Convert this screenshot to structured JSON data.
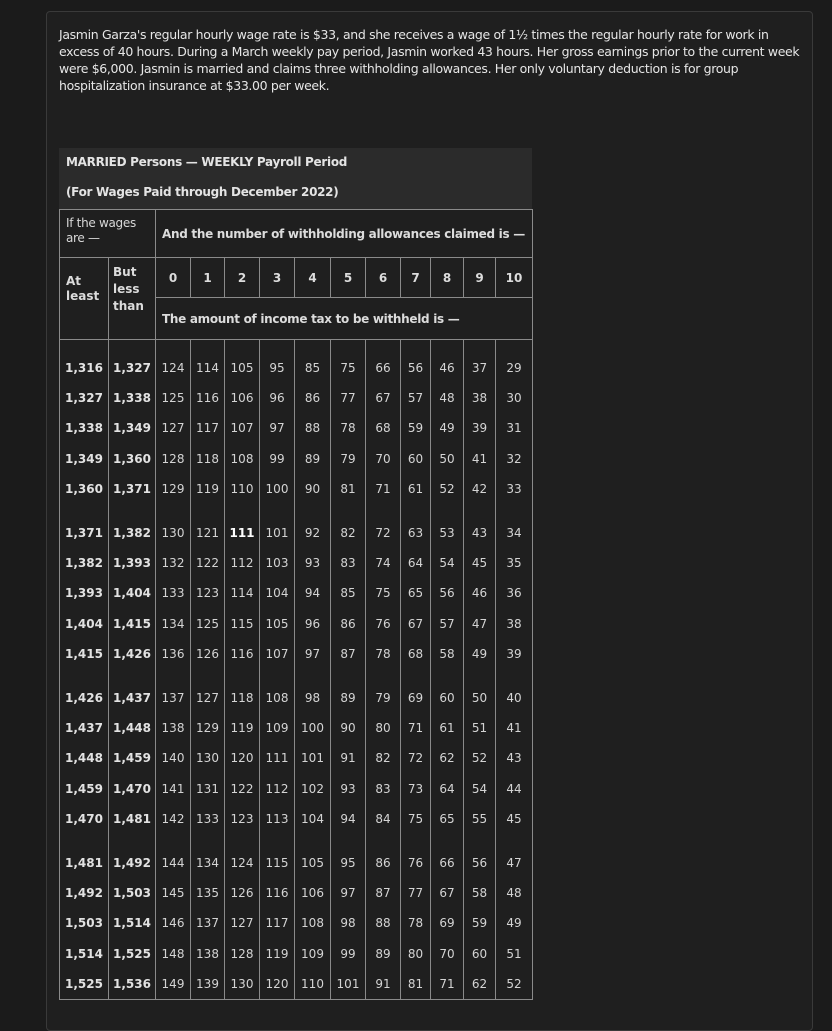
{
  "problem_text": "Jasmin Garza's regular hourly wage rate is $33, and she receives a wage of 1½ times the regular hourly rate for work in excess of 40 hours. During a March weekly pay period, Jasmin worked 43 hours. Her gross earnings prior to the current week were $6,000. Jasmin is married and claims three withholding allowances. Her only voluntary deduction is for group hospitalization insurance at $33.00 per week.",
  "table": {
    "title": "MARRIED Persons — WEEKLY Payroll Period",
    "subtitle": "(For Wages Paid through December 2022)",
    "wages_header": "If the wages are —",
    "allowances_header": "And the number of withholding allowances claimed is —",
    "at_least_header": "At least",
    "but_less_header": "But less than",
    "amount_header": "The amount of income tax to be withheld is —",
    "allowance_numbers": [
      "0",
      "1",
      "2",
      "3",
      "4",
      "5",
      "6",
      "7",
      "8",
      "9",
      "10"
    ],
    "groups": [
      [
        [
          "1,316",
          "1,327",
          "124",
          "114",
          "105",
          "95",
          "85",
          "75",
          "66",
          "56",
          "46",
          "37",
          "29"
        ],
        [
          "1,327",
          "1,338",
          "125",
          "116",
          "106",
          "96",
          "86",
          "77",
          "67",
          "57",
          "48",
          "38",
          "30"
        ],
        [
          "1,338",
          "1,349",
          "127",
          "117",
          "107",
          "97",
          "88",
          "78",
          "68",
          "59",
          "49",
          "39",
          "31"
        ],
        [
          "1,349",
          "1,360",
          "128",
          "118",
          "108",
          "99",
          "89",
          "79",
          "70",
          "60",
          "50",
          "41",
          "32"
        ],
        [
          "1,360",
          "1,371",
          "129",
          "119",
          "110",
          "100",
          "90",
          "81",
          "71",
          "61",
          "52",
          "42",
          "33"
        ]
      ],
      [
        [
          "1,371",
          "1,382",
          "130",
          "121",
          "111",
          "101",
          "92",
          "82",
          "72",
          "63",
          "53",
          "43",
          "34"
        ],
        [
          "1,382",
          "1,393",
          "132",
          "122",
          "112",
          "103",
          "93",
          "83",
          "74",
          "64",
          "54",
          "45",
          "35"
        ],
        [
          "1,393",
          "1,404",
          "133",
          "123",
          "114",
          "104",
          "94",
          "85",
          "75",
          "65",
          "56",
          "46",
          "36"
        ],
        [
          "1,404",
          "1,415",
          "134",
          "125",
          "115",
          "105",
          "96",
          "86",
          "76",
          "67",
          "57",
          "47",
          "38"
        ],
        [
          "1,415",
          "1,426",
          "136",
          "126",
          "116",
          "107",
          "97",
          "87",
          "78",
          "68",
          "58",
          "49",
          "39"
        ]
      ],
      [
        [
          "1,426",
          "1,437",
          "137",
          "127",
          "118",
          "108",
          "98",
          "89",
          "79",
          "69",
          "60",
          "50",
          "40"
        ],
        [
          "1,437",
          "1,448",
          "138",
          "129",
          "119",
          "109",
          "100",
          "90",
          "80",
          "71",
          "61",
          "51",
          "41"
        ],
        [
          "1,448",
          "1,459",
          "140",
          "130",
          "120",
          "111",
          "101",
          "91",
          "82",
          "72",
          "62",
          "52",
          "43"
        ],
        [
          "1,459",
          "1,470",
          "141",
          "131",
          "122",
          "112",
          "102",
          "93",
          "83",
          "73",
          "64",
          "54",
          "44"
        ],
        [
          "1,470",
          "1,481",
          "142",
          "133",
          "123",
          "113",
          "104",
          "94",
          "84",
          "75",
          "65",
          "55",
          "45"
        ]
      ],
      [
        [
          "1,481",
          "1,492",
          "144",
          "134",
          "124",
          "115",
          "105",
          "95",
          "86",
          "76",
          "66",
          "56",
          "47"
        ],
        [
          "1,492",
          "1,503",
          "145",
          "135",
          "126",
          "116",
          "106",
          "97",
          "87",
          "77",
          "67",
          "58",
          "48"
        ],
        [
          "1,503",
          "1,514",
          "146",
          "137",
          "127",
          "117",
          "108",
          "98",
          "88",
          "78",
          "69",
          "59",
          "49"
        ],
        [
          "1,514",
          "1,525",
          "148",
          "138",
          "128",
          "119",
          "109",
          "99",
          "89",
          "80",
          "70",
          "60",
          "51"
        ],
        [
          "1,525",
          "1,536",
          "149",
          "139",
          "130",
          "120",
          "110",
          "101",
          "91",
          "81",
          "71",
          "62",
          "52"
        ]
      ]
    ]
  }
}
